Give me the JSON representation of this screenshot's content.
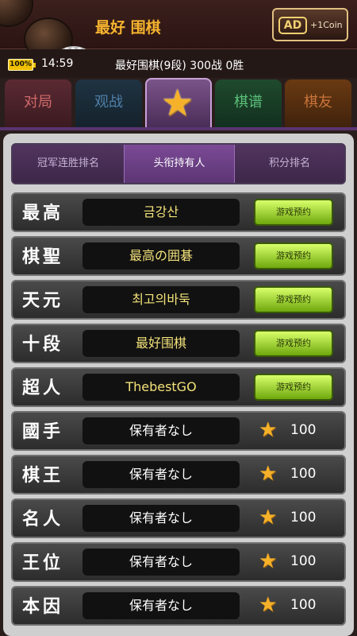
{
  "header": {
    "title": "最好 围棋",
    "ad_badge": "AD",
    "ad_reward": "+1Coin"
  },
  "status": {
    "battery": "100%",
    "time": "14:59",
    "player_info": "最好围棋(9段) 300战 0胜"
  },
  "main_tabs": [
    "对局",
    "观战",
    "star-icon",
    "棋谱",
    "棋友"
  ],
  "sub_tabs": [
    "冠军连胜排名",
    "头衔持有人",
    "积分排名"
  ],
  "rows": [
    {
      "title": "最高",
      "holder": "금강산",
      "action": "游戏预约"
    },
    {
      "title": "棋聖",
      "holder": "最高の囲碁",
      "action": "游戏预约"
    },
    {
      "title": "天元",
      "holder": "최고의바둑",
      "action": "游戏预约"
    },
    {
      "title": "十段",
      "holder": "最好围棋",
      "action": "游戏预约"
    },
    {
      "title": "超人",
      "holder": "ThebestGO",
      "action": "游戏预约"
    },
    {
      "title": "國手",
      "holder": "保有者なし",
      "points": "100"
    },
    {
      "title": "棋王",
      "holder": "保有者なし",
      "points": "100"
    },
    {
      "title": "名人",
      "holder": "保有者なし",
      "points": "100"
    },
    {
      "title": "王位",
      "holder": "保有者なし",
      "points": "100"
    },
    {
      "title": "本因",
      "holder": "保有者なし",
      "points": "100"
    }
  ],
  "colors": {
    "accent_orange": "#f5b32e",
    "reserve_green": "#8fd41c",
    "selected_purple": "#7b4a96"
  }
}
